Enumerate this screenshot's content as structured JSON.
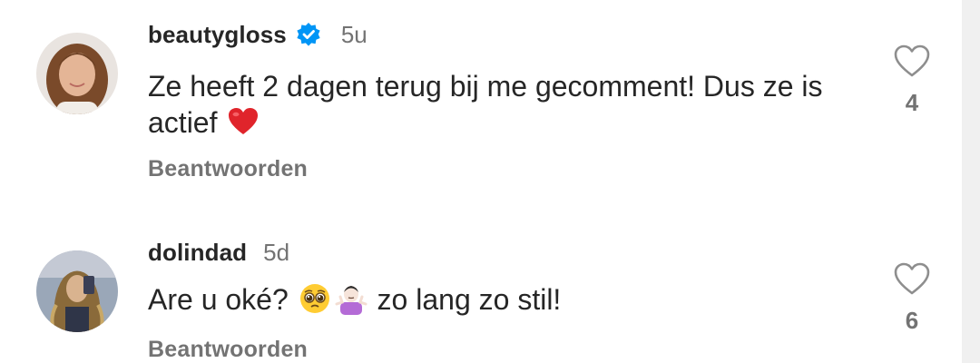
{
  "comments": [
    {
      "username": "beautygloss",
      "verified": true,
      "time": "5u",
      "text": "Ze heeft 2 dagen terug bij me gecomment! Dus ze is actief",
      "emoji": [
        "red-heart"
      ],
      "reply_label": "Beantwoorden",
      "likes": "4"
    },
    {
      "username": "dolindad",
      "verified": false,
      "time": "5d",
      "text_before": "Are u oké?",
      "text_after": "zo lang zo stil!",
      "emoji": [
        "pleading-face",
        "person-shrugging"
      ],
      "reply_label": "Beantwoorden",
      "likes": "6"
    }
  ],
  "colors": {
    "username": "#262626",
    "secondary_text": "#737373",
    "verified_badge": "#0095f6",
    "heart_outline": "#8e8e8e",
    "emoji_heart": "#e0242b"
  }
}
